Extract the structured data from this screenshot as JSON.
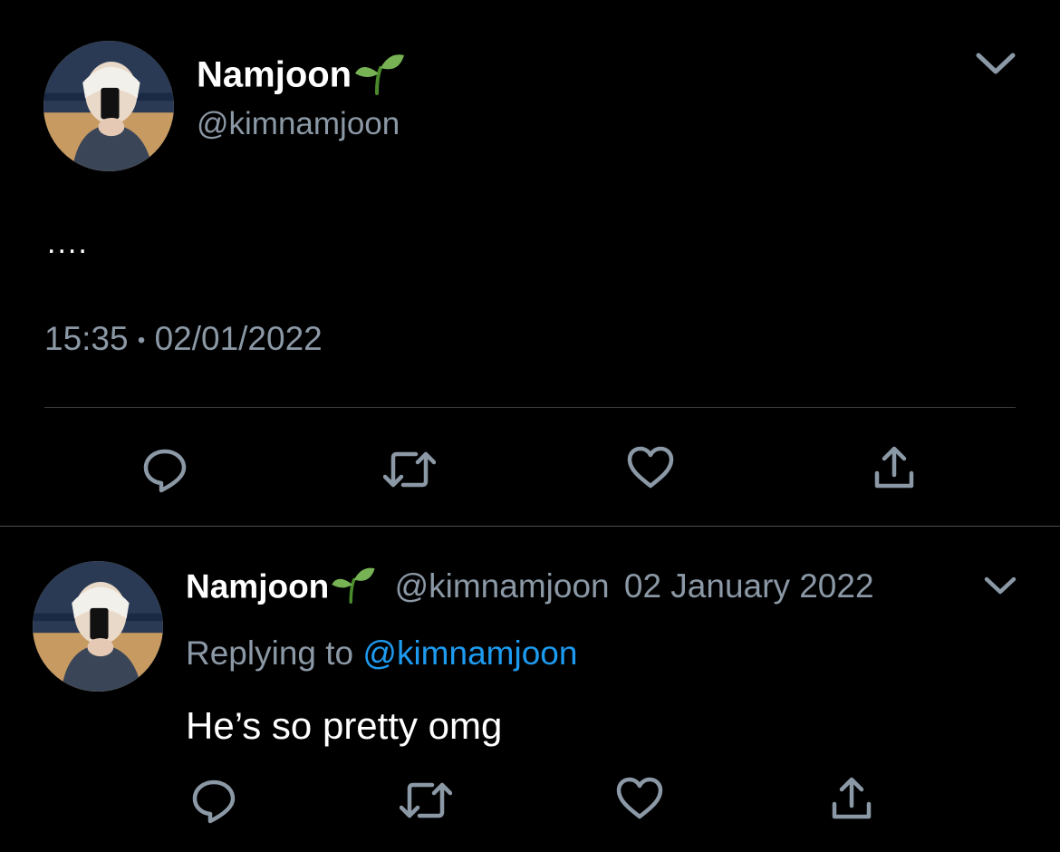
{
  "main_tweet": {
    "display_name": "Namjoon",
    "name_emoji": "sprout",
    "handle": "@kimnamjoon",
    "text": "....",
    "time": "15:35",
    "separator": "•",
    "date": "02/01/2022",
    "menu_icon": "chevron-down-icon",
    "actions": [
      "reply-icon",
      "retweet-icon",
      "like-icon",
      "share-icon"
    ]
  },
  "reply_tweet": {
    "display_name": "Namjoon",
    "name_emoji": "sprout",
    "handle": "@kimnamjoon",
    "date": "02 January 2022",
    "replying_prefix": "Replying to",
    "replying_handle": "@kimnamjoon",
    "text": "He’s so pretty omg",
    "menu_icon": "chevron-down-icon",
    "actions": [
      "reply-icon",
      "retweet-icon",
      "like-icon",
      "share-icon"
    ]
  },
  "colors": {
    "background": "#000000",
    "text": "#ffffff",
    "secondary": "#8b98a5",
    "link": "#1d9bf0",
    "divider": "#3a3d40",
    "icon": "#8b98a5"
  }
}
